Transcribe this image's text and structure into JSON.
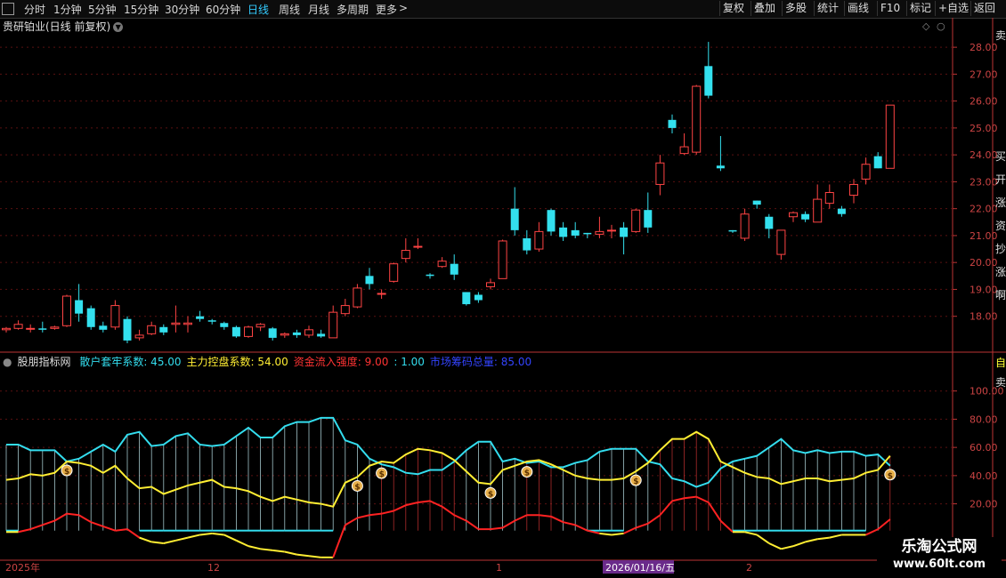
{
  "toolbar": {
    "left": [
      {
        "label": "分时",
        "x": 27
      },
      {
        "label": "1分钟",
        "x": 60
      },
      {
        "label": "5分钟",
        "x": 99
      },
      {
        "label": "15分钟",
        "x": 139
      },
      {
        "label": "30分钟",
        "x": 185
      },
      {
        "label": "60分钟",
        "x": 231
      },
      {
        "label": "日线",
        "x": 278,
        "active": true
      },
      {
        "label": "周线",
        "x": 313
      },
      {
        "label": "月线",
        "x": 346
      },
      {
        "label": "多周期",
        "x": 378
      },
      {
        "label": "更多",
        "x": 422
      }
    ],
    "more_arrow": ">",
    "right": [
      {
        "label": "复权",
        "x": 808
      },
      {
        "label": "叠加",
        "x": 843
      },
      {
        "label": "多股",
        "x": 878
      },
      {
        "label": "统计",
        "x": 914
      },
      {
        "label": "画线",
        "x": 948
      },
      {
        "label": "F10",
        "x": 985
      },
      {
        "label": "标记",
        "x": 1018
      },
      {
        "label": "+自选",
        "x": 1050
      },
      {
        "label": "返回",
        "x": 1090
      }
    ]
  },
  "chart_title": "贵研铂业(日线 前复权)",
  "indicator": {
    "name": "股朋指标网",
    "labels": [
      {
        "text": "散户套牢系数: 45.00",
        "color": "#33ddee"
      },
      {
        "text": "主力控盘系数: 54.00",
        "color": "#ffee33"
      },
      {
        "text": "资金流入强度: 9.00",
        "color": "#ff3333"
      },
      {
        "text": ": 1.00",
        "color": "#33ddee"
      },
      {
        "text": "市场筹码总量: 85.00",
        "color": "#3344ff"
      }
    ]
  },
  "date_labels": [
    {
      "text": "2025年",
      "x": 6
    },
    {
      "text": "12",
      "x": 233
    },
    {
      "text": "1",
      "x": 557
    },
    {
      "text": "2",
      "x": 838
    }
  ],
  "date_highlight": "2026/01/16/五",
  "watermark": {
    "line1": "乐淘公式网",
    "line2": "www.60lt.com"
  },
  "right_cutoff_text": {
    "upper": [
      "卖",
      "买买买买",
      "开涨涨涨",
      "涨资",
      "资外",
      "抄",
      "涨",
      "啊"
    ],
    "lower": [
      "自",
      "卖"
    ]
  },
  "chart_data": [
    {
      "type": "candlestick",
      "ylim": [
        16.8,
        28.5
      ],
      "ticks": [
        18,
        19,
        20,
        21,
        22,
        23,
        24,
        25,
        26,
        27,
        28
      ],
      "candles": [
        [
          17.5,
          17.55,
          17.4,
          17.6
        ],
        [
          17.55,
          17.7,
          17.5,
          17.85
        ],
        [
          17.55,
          17.55,
          17.4,
          17.7
        ],
        [
          17.55,
          17.5,
          17.4,
          17.8
        ],
        [
          17.55,
          17.6,
          17.5,
          17.65
        ],
        [
          17.65,
          18.75,
          17.6,
          18.8
        ],
        [
          18.6,
          18.1,
          17.8,
          19.2
        ],
        [
          18.3,
          17.6,
          17.5,
          18.4
        ],
        [
          17.65,
          17.5,
          17.4,
          17.8
        ],
        [
          17.6,
          18.4,
          17.5,
          18.6
        ],
        [
          17.9,
          17.1,
          17.0,
          18.0
        ],
        [
          17.2,
          17.3,
          17.1,
          17.5
        ],
        [
          17.35,
          17.65,
          17.3,
          17.8
        ],
        [
          17.6,
          17.4,
          17.3,
          17.7
        ],
        [
          17.7,
          17.75,
          17.4,
          18.4
        ],
        [
          17.7,
          17.75,
          17.4,
          18.0
        ],
        [
          18.0,
          17.9,
          17.8,
          18.2
        ],
        [
          17.85,
          17.8,
          17.7,
          17.9
        ],
        [
          17.75,
          17.6,
          17.5,
          17.8
        ],
        [
          17.6,
          17.25,
          17.2,
          17.65
        ],
        [
          17.25,
          17.6,
          17.2,
          17.65
        ],
        [
          17.6,
          17.7,
          17.45,
          17.75
        ],
        [
          17.55,
          17.2,
          17.1,
          17.6
        ],
        [
          17.3,
          17.35,
          17.2,
          17.4
        ],
        [
          17.4,
          17.3,
          17.2,
          17.5
        ],
        [
          17.3,
          17.5,
          17.2,
          17.65
        ],
        [
          17.35,
          17.25,
          17.2,
          17.5
        ],
        [
          17.2,
          18.15,
          17.2,
          18.4
        ],
        [
          18.1,
          18.4,
          18.0,
          18.65
        ],
        [
          18.35,
          19.05,
          18.3,
          19.2
        ],
        [
          19.5,
          19.2,
          19.0,
          19.8
        ],
        [
          18.85,
          18.85,
          18.65,
          19.0
        ],
        [
          19.3,
          19.95,
          19.25,
          20.0
        ],
        [
          20.15,
          20.45,
          20.0,
          20.9
        ],
        [
          20.6,
          20.6,
          20.5,
          20.9
        ],
        [
          19.55,
          19.5,
          19.4,
          19.6
        ],
        [
          19.85,
          20.05,
          19.8,
          20.2
        ],
        [
          19.95,
          19.55,
          19.35,
          20.3
        ],
        [
          18.9,
          18.45,
          18.4,
          18.9
        ],
        [
          18.8,
          18.6,
          18.5,
          18.9
        ],
        [
          19.1,
          19.25,
          19.0,
          19.4
        ],
        [
          19.4,
          20.8,
          19.4,
          20.85
        ],
        [
          22.0,
          21.2,
          21.0,
          22.8
        ],
        [
          20.9,
          20.45,
          20.3,
          21.2
        ],
        [
          20.5,
          21.15,
          20.4,
          21.5
        ],
        [
          21.95,
          21.15,
          21.0,
          22.0
        ],
        [
          21.3,
          20.95,
          20.8,
          21.5
        ],
        [
          21.2,
          21.0,
          20.9,
          21.5
        ],
        [
          21.1,
          21.05,
          20.9,
          21.1
        ],
        [
          21.05,
          21.15,
          20.9,
          21.7
        ],
        [
          21.2,
          21.2,
          20.9,
          21.4
        ],
        [
          21.3,
          20.95,
          20.3,
          21.5
        ],
        [
          21.15,
          21.95,
          21.1,
          22.0
        ],
        [
          21.95,
          21.3,
          21.1,
          22.6
        ],
        [
          22.9,
          23.7,
          22.5,
          24.0
        ],
        [
          25.3,
          25.0,
          24.8,
          25.5
        ],
        [
          24.05,
          24.3,
          24.0,
          24.8
        ],
        [
          24.1,
          26.55,
          24.0,
          26.6
        ],
        [
          27.3,
          26.2,
          26.1,
          28.2
        ],
        [
          23.6,
          23.5,
          23.4,
          24.7
        ],
        [
          21.2,
          21.15,
          21.1,
          21.2
        ],
        [
          20.9,
          21.8,
          20.8,
          22.0
        ],
        [
          22.3,
          22.15,
          22.0,
          22.3
        ],
        [
          21.7,
          21.25,
          20.9,
          21.8
        ],
        [
          20.3,
          21.2,
          20.1,
          21.2
        ],
        [
          21.7,
          21.85,
          21.5,
          21.9
        ],
        [
          21.8,
          21.6,
          21.5,
          21.9
        ],
        [
          21.5,
          22.35,
          21.5,
          22.9
        ],
        [
          22.2,
          22.6,
          22.0,
          22.9
        ],
        [
          22.0,
          21.8,
          21.7,
          22.1
        ],
        [
          22.5,
          22.9,
          22.2,
          23.1
        ],
        [
          23.1,
          23.65,
          22.9,
          23.9
        ],
        [
          23.95,
          23.5,
          23.5,
          24.1
        ],
        [
          23.5,
          25.85,
          23.5,
          25.85
        ]
      ]
    },
    {
      "type": "line",
      "ylim": [
        -20,
        120
      ],
      "ticks": [
        20,
        40,
        60,
        80,
        100
      ],
      "series": [
        {
          "name": "散户套牢系数",
          "color": "#33ddee",
          "values": [
            62,
            62,
            58,
            58,
            58,
            50,
            52,
            57,
            62,
            57,
            69,
            71,
            61,
            62,
            68,
            70,
            62,
            61,
            62,
            68,
            74,
            67,
            67,
            75,
            78,
            78,
            81,
            81,
            65,
            62,
            52,
            48,
            46,
            42,
            41,
            44,
            44,
            50,
            58,
            64,
            64,
            50,
            52,
            49,
            50,
            46,
            46,
            49,
            51,
            57,
            59,
            59,
            59,
            50,
            48,
            38,
            36,
            32,
            35,
            45,
            50,
            52,
            54,
            60,
            66,
            58,
            56,
            58,
            56,
            57,
            57,
            54,
            55,
            47
          ]
        },
        {
          "name": "主力控盘系数",
          "color": "#ffee33",
          "values": [
            37,
            38,
            41,
            40,
            42,
            50,
            49,
            47,
            42,
            47,
            38,
            31,
            32,
            27,
            30,
            33,
            35,
            37,
            32,
            31,
            29,
            25,
            22,
            25,
            23,
            21,
            20,
            18,
            35,
            39,
            47,
            50,
            49,
            55,
            59,
            58,
            56,
            51,
            43,
            35,
            34,
            44,
            47,
            50,
            51,
            48,
            44,
            40,
            38,
            37,
            37,
            38,
            43,
            49,
            58,
            66,
            66,
            71,
            66,
            50,
            46,
            42,
            39,
            38,
            34,
            36,
            38,
            38,
            36,
            37,
            38,
            42,
            44,
            54
          ]
        },
        {
          "name": "资金流入强度",
          "color": "#ff3333",
          "values": [
            0,
            0,
            2,
            5,
            8,
            13,
            12,
            7,
            4,
            1,
            2,
            -4,
            -7,
            -8,
            -6,
            -4,
            -2,
            -1,
            -2,
            -6,
            -10,
            -12,
            -13,
            -14,
            -16,
            -17,
            -18,
            -18,
            5,
            10,
            12,
            13,
            15,
            19,
            21,
            22,
            18,
            12,
            8,
            2,
            2,
            3,
            8,
            12,
            12,
            11,
            7,
            5,
            1,
            -1,
            -2,
            -1,
            3,
            6,
            12,
            22,
            24,
            25,
            21,
            8,
            0,
            0,
            -2,
            -8,
            -12,
            -10,
            -7,
            -5,
            -4,
            -2,
            -2,
            -2,
            2,
            9
          ]
        },
        {
          "name": "",
          "color": "#33ddee",
          "values": [
            1,
            1,
            1,
            1,
            1,
            1,
            1,
            1,
            1,
            1,
            1,
            1,
            1,
            1,
            1,
            1,
            1,
            1,
            1,
            1,
            1,
            1,
            1,
            1,
            1,
            1,
            1,
            1,
            1,
            1,
            1,
            1,
            1,
            1,
            1,
            1,
            1,
            1,
            1,
            1,
            1,
            1,
            1,
            1,
            1,
            1,
            1,
            1,
            1,
            1,
            1,
            1,
            1,
            1,
            1,
            1,
            1,
            1,
            1,
            1,
            1,
            1,
            1,
            1,
            1,
            1,
            1,
            1,
            1,
            1,
            1,
            1,
            1,
            1
          ]
        }
      ],
      "signal_indices": [
        5,
        29,
        31,
        40,
        43,
        52,
        73
      ]
    }
  ]
}
